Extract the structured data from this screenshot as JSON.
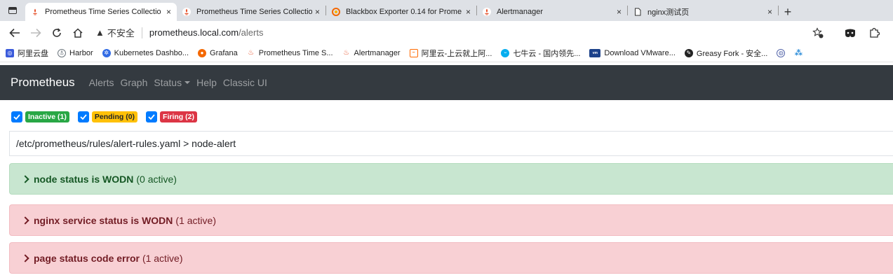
{
  "browser": {
    "tabs": [
      {
        "label": "Prometheus Time Series Collectio",
        "icon": "prometheus-icon",
        "active": true
      },
      {
        "label": "Prometheus Time Series Collectio",
        "icon": "prometheus-icon",
        "active": false
      },
      {
        "label": "Blackbox Exporter 0.14 for Prome",
        "icon": "grafana-icon",
        "active": false
      },
      {
        "label": "Alertmanager",
        "icon": "prometheus-icon",
        "active": false
      },
      {
        "label": "nginx测试页",
        "icon": "page-icon",
        "active": false
      }
    ],
    "close_glyph": "×",
    "new_tab_glyph": "+",
    "address": {
      "warning_glyph": "▲",
      "insecure_label": "不安全",
      "host": "prometheus.local.com",
      "path": "/alerts"
    },
    "bookmarks": [
      {
        "label": "阿里云盘",
        "icon": "aliyun-drive-icon",
        "color": "#3b5bdb"
      },
      {
        "label": "Harbor",
        "icon": "harbor-icon",
        "color": "#6c757d"
      },
      {
        "label": "Kubernetes Dashbo...",
        "icon": "kubernetes-icon",
        "color": "#326ce5"
      },
      {
        "label": "Grafana",
        "icon": "grafana-icon",
        "color": "#f46800"
      },
      {
        "label": "Prometheus Time S...",
        "icon": "prometheus-icon",
        "color": "#e6522c"
      },
      {
        "label": "Alertmanager",
        "icon": "prometheus-icon",
        "color": "#e6522c"
      },
      {
        "label": "阿里云-上云就上阿...",
        "icon": "aliyun-icon",
        "color": "#ff6a00"
      },
      {
        "label": "七牛云 - 国内领先...",
        "icon": "qiniu-icon",
        "color": "#06aeef"
      },
      {
        "label": "Download VMware...",
        "icon": "vmware-icon",
        "color": "#1d428a"
      },
      {
        "label": "Greasy Fork - 安全...",
        "icon": "greasyfork-icon",
        "color": "#222222"
      }
    ]
  },
  "navbar": {
    "brand": "Prometheus",
    "links": [
      "Alerts",
      "Graph",
      "Status",
      "Help",
      "Classic UI"
    ]
  },
  "filters": [
    {
      "label": "Inactive (1)",
      "color": "#28a745",
      "checked": true
    },
    {
      "label": "Pending (0)",
      "color": "#ffc107",
      "checked": true
    },
    {
      "label": "Firing (2)",
      "color": "#dc3545",
      "checked": true
    }
  ],
  "rule_file": "/etc/prometheus/rules/alert-rules.yaml > node-alert",
  "alerts": [
    {
      "name": "node status is WODN",
      "count": "(0 active)",
      "state": "inactive"
    },
    {
      "name": "nginx service status is WODN",
      "count": "(1 active)",
      "state": "firing"
    },
    {
      "name": "page status code error",
      "count": "(1 active)",
      "state": "firing"
    }
  ]
}
